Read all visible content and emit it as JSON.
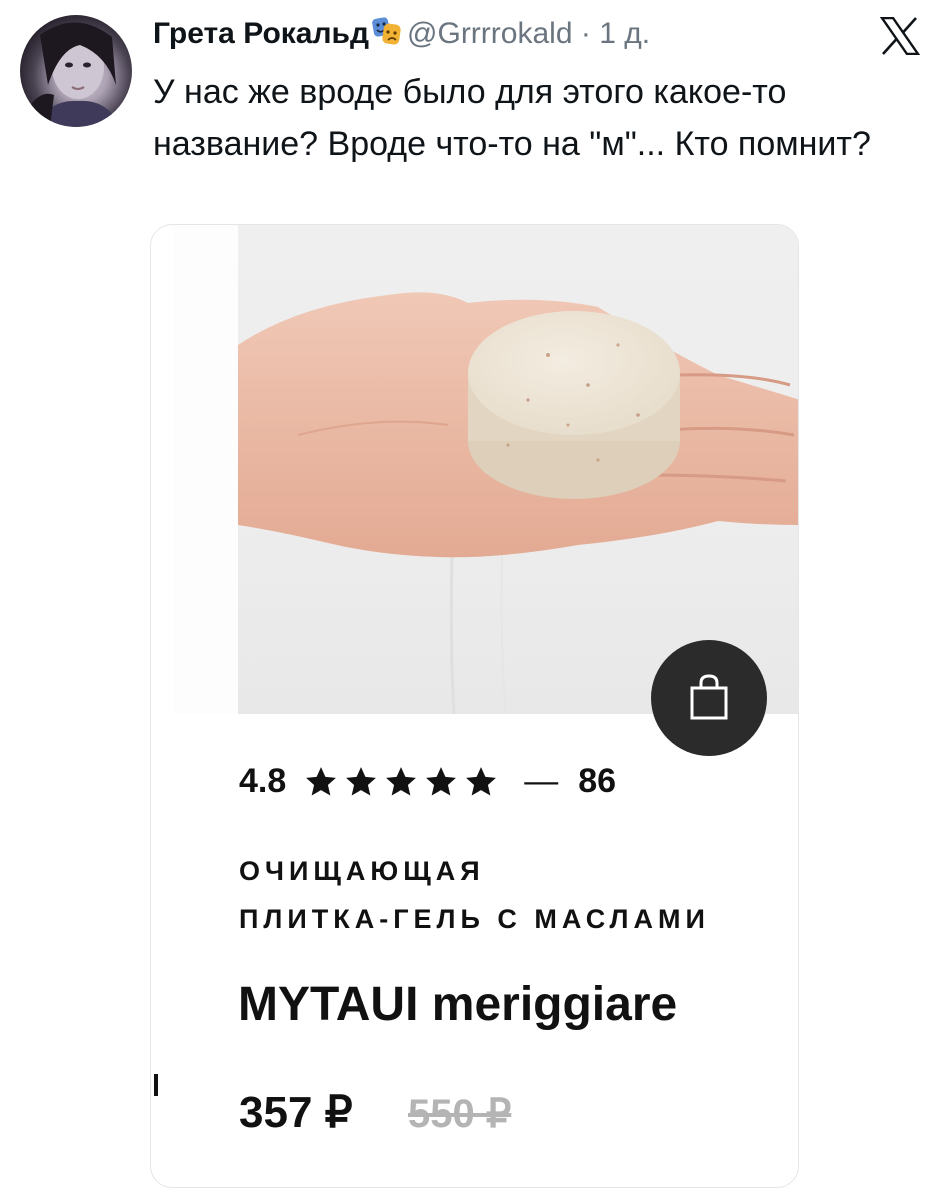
{
  "tweet": {
    "author_name": "Грета Рокальд",
    "author_emoji": "performing-arts-emoji",
    "handle": "@Grrrrokald",
    "separator": "·",
    "time": "1 д.",
    "text": "У нас же вроде было для этого какое-то название? Вроде что-то на \"м\"... Кто помнит?",
    "platform_icon": "x-logo-icon"
  },
  "product_card": {
    "image": "hand-holding-soap-bar",
    "cart_icon": "shopping-bag-icon",
    "rating": {
      "value": "4.8",
      "stars": 5,
      "dash": "—",
      "reviews_count": "86"
    },
    "category_line1": "ОЧИЩАЮЩАЯ",
    "category_line2": "ПЛИТКА-ГЕЛЬ С МАСЛАМИ",
    "brand": "MYTAUI meriggiare",
    "price": "357 ₽",
    "old_price": "550 ₽"
  },
  "colors": {
    "text": "#0f1419",
    "secondary_text": "#6b7580",
    "cart_button": "#2b2b2b",
    "old_price": "#b4b4b4"
  }
}
